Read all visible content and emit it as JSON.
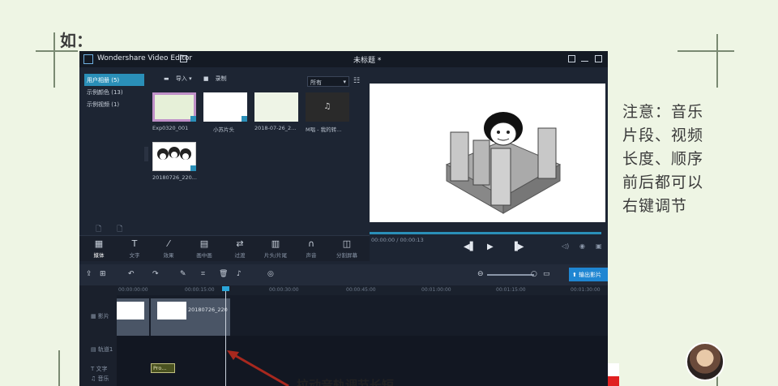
{
  "slide": {
    "heading": "如：",
    "note_lines": [
      "注意：音乐",
      "片段、视频",
      "长度、顺序",
      "前后都可以",
      "右键调节"
    ],
    "annotation": "拉动音轨调节长短"
  },
  "window": {
    "app_name": "Wondershare Video Editor",
    "doc_title": "未标题 *"
  },
  "library": {
    "categories": [
      {
        "label": "用户相册 (5)",
        "active": true
      },
      {
        "label": "示例颜色 (13)",
        "active": false
      },
      {
        "label": "示例视频 (1)",
        "active": false
      }
    ],
    "import_label": "导入 ▾",
    "record_label": "录制",
    "filter_value": "所有",
    "items": [
      {
        "name": "Exp0320_001"
      },
      {
        "name": "小苏片头"
      },
      {
        "name": "2018-07-26_2..."
      },
      {
        "name": "M唱 - 我的转..."
      },
      {
        "name": "20180726_220..."
      }
    ]
  },
  "player": {
    "time": "00:00:00 / 00:00:13"
  },
  "tabs": [
    {
      "label": "媒体",
      "icon": "film-icon"
    },
    {
      "label": "文字",
      "icon": "text-icon"
    },
    {
      "label": "效果",
      "icon": "magic-wand-icon"
    },
    {
      "label": "画中画",
      "icon": "pip-icon"
    },
    {
      "label": "过渡",
      "icon": "transition-icon"
    },
    {
      "label": "片头/片尾",
      "icon": "clapper-icon"
    },
    {
      "label": "声音",
      "icon": "headphones-icon"
    },
    {
      "label": "分割屏幕",
      "icon": "split-screen-icon"
    }
  ],
  "timeline": {
    "export_label": "输出影片",
    "ruler_ticks": [
      "00:00:00:00",
      "00:00:15:00",
      "00:00:30:00",
      "00:00:45:00",
      "00:01:00:00",
      "00:01:15:00",
      "00:01:30:00"
    ],
    "tracks": [
      "影片",
      "轨道1",
      "文字",
      "音乐"
    ],
    "clip_name": "20180726_220",
    "text_clip": "Pro..."
  }
}
